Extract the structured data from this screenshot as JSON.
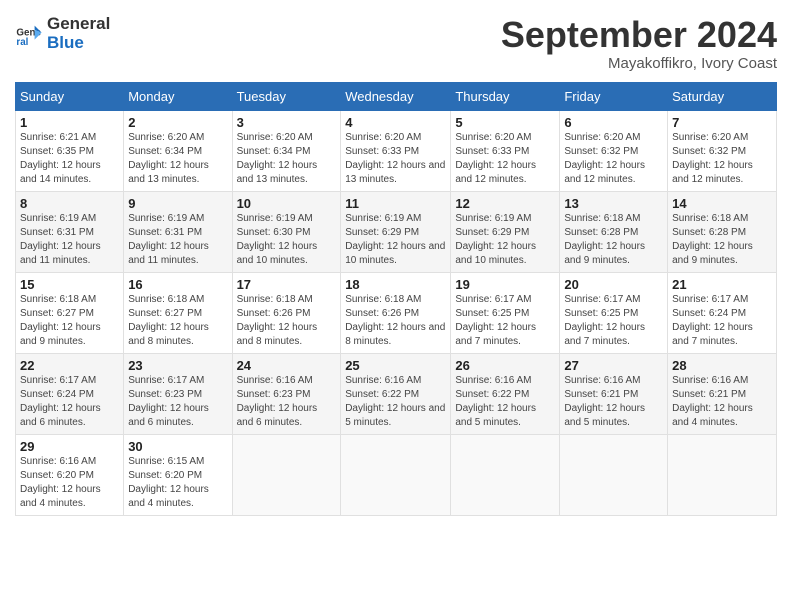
{
  "header": {
    "logo_line1": "General",
    "logo_line2": "Blue",
    "month_title": "September 2024",
    "location": "Mayakoffikro, Ivory Coast"
  },
  "days_of_week": [
    "Sunday",
    "Monday",
    "Tuesday",
    "Wednesday",
    "Thursday",
    "Friday",
    "Saturday"
  ],
  "weeks": [
    [
      {
        "day": "1",
        "sunrise": "6:21 AM",
        "sunset": "6:35 PM",
        "daylight": "12 hours and 14 minutes."
      },
      {
        "day": "2",
        "sunrise": "6:20 AM",
        "sunset": "6:34 PM",
        "daylight": "12 hours and 13 minutes."
      },
      {
        "day": "3",
        "sunrise": "6:20 AM",
        "sunset": "6:34 PM",
        "daylight": "12 hours and 13 minutes."
      },
      {
        "day": "4",
        "sunrise": "6:20 AM",
        "sunset": "6:33 PM",
        "daylight": "12 hours and 13 minutes."
      },
      {
        "day": "5",
        "sunrise": "6:20 AM",
        "sunset": "6:33 PM",
        "daylight": "12 hours and 12 minutes."
      },
      {
        "day": "6",
        "sunrise": "6:20 AM",
        "sunset": "6:32 PM",
        "daylight": "12 hours and 12 minutes."
      },
      {
        "day": "7",
        "sunrise": "6:20 AM",
        "sunset": "6:32 PM",
        "daylight": "12 hours and 12 minutes."
      }
    ],
    [
      {
        "day": "8",
        "sunrise": "6:19 AM",
        "sunset": "6:31 PM",
        "daylight": "12 hours and 11 minutes."
      },
      {
        "day": "9",
        "sunrise": "6:19 AM",
        "sunset": "6:31 PM",
        "daylight": "12 hours and 11 minutes."
      },
      {
        "day": "10",
        "sunrise": "6:19 AM",
        "sunset": "6:30 PM",
        "daylight": "12 hours and 10 minutes."
      },
      {
        "day": "11",
        "sunrise": "6:19 AM",
        "sunset": "6:29 PM",
        "daylight": "12 hours and 10 minutes."
      },
      {
        "day": "12",
        "sunrise": "6:19 AM",
        "sunset": "6:29 PM",
        "daylight": "12 hours and 10 minutes."
      },
      {
        "day": "13",
        "sunrise": "6:18 AM",
        "sunset": "6:28 PM",
        "daylight": "12 hours and 9 minutes."
      },
      {
        "day": "14",
        "sunrise": "6:18 AM",
        "sunset": "6:28 PM",
        "daylight": "12 hours and 9 minutes."
      }
    ],
    [
      {
        "day": "15",
        "sunrise": "6:18 AM",
        "sunset": "6:27 PM",
        "daylight": "12 hours and 9 minutes."
      },
      {
        "day": "16",
        "sunrise": "6:18 AM",
        "sunset": "6:27 PM",
        "daylight": "12 hours and 8 minutes."
      },
      {
        "day": "17",
        "sunrise": "6:18 AM",
        "sunset": "6:26 PM",
        "daylight": "12 hours and 8 minutes."
      },
      {
        "day": "18",
        "sunrise": "6:18 AM",
        "sunset": "6:26 PM",
        "daylight": "12 hours and 8 minutes."
      },
      {
        "day": "19",
        "sunrise": "6:17 AM",
        "sunset": "6:25 PM",
        "daylight": "12 hours and 7 minutes."
      },
      {
        "day": "20",
        "sunrise": "6:17 AM",
        "sunset": "6:25 PM",
        "daylight": "12 hours and 7 minutes."
      },
      {
        "day": "21",
        "sunrise": "6:17 AM",
        "sunset": "6:24 PM",
        "daylight": "12 hours and 7 minutes."
      }
    ],
    [
      {
        "day": "22",
        "sunrise": "6:17 AM",
        "sunset": "6:24 PM",
        "daylight": "12 hours and 6 minutes."
      },
      {
        "day": "23",
        "sunrise": "6:17 AM",
        "sunset": "6:23 PM",
        "daylight": "12 hours and 6 minutes."
      },
      {
        "day": "24",
        "sunrise": "6:16 AM",
        "sunset": "6:23 PM",
        "daylight": "12 hours and 6 minutes."
      },
      {
        "day": "25",
        "sunrise": "6:16 AM",
        "sunset": "6:22 PM",
        "daylight": "12 hours and 5 minutes."
      },
      {
        "day": "26",
        "sunrise": "6:16 AM",
        "sunset": "6:22 PM",
        "daylight": "12 hours and 5 minutes."
      },
      {
        "day": "27",
        "sunrise": "6:16 AM",
        "sunset": "6:21 PM",
        "daylight": "12 hours and 5 minutes."
      },
      {
        "day": "28",
        "sunrise": "6:16 AM",
        "sunset": "6:21 PM",
        "daylight": "12 hours and 4 minutes."
      }
    ],
    [
      {
        "day": "29",
        "sunrise": "6:16 AM",
        "sunset": "6:20 PM",
        "daylight": "12 hours and 4 minutes."
      },
      {
        "day": "30",
        "sunrise": "6:15 AM",
        "sunset": "6:20 PM",
        "daylight": "12 hours and 4 minutes."
      },
      null,
      null,
      null,
      null,
      null
    ]
  ]
}
